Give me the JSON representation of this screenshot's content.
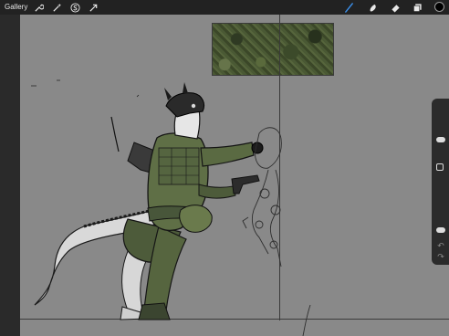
{
  "topbar": {
    "gallery_label": "Gallery",
    "actions_icon": "wrench-icon",
    "adjustments_icon": "magic-wand-icon",
    "selection_icon": "selection-s-icon",
    "transform_icon": "transform-arrow-icon",
    "brush_icon": "brush-icon",
    "smudge_icon": "smudge-icon",
    "eraser_icon": "eraser-icon",
    "layers_icon": "layers-icon",
    "current_color": "#000000",
    "active_tool_color": "#3b8ee8"
  },
  "sidebar": {
    "size_slider_icon": "slider-thumb",
    "opacity_slider_icon": "slider-thumb",
    "modify_icon": "square-icon",
    "undo_icon": "undo-arrow-icon",
    "redo_icon": "redo-arrow-icon"
  },
  "canvas": {
    "background_color": "#898989",
    "camo_swatch_colors": [
      "#2f3a23",
      "#3c4a2a",
      "#5a6a3c",
      "#66744a"
    ]
  }
}
